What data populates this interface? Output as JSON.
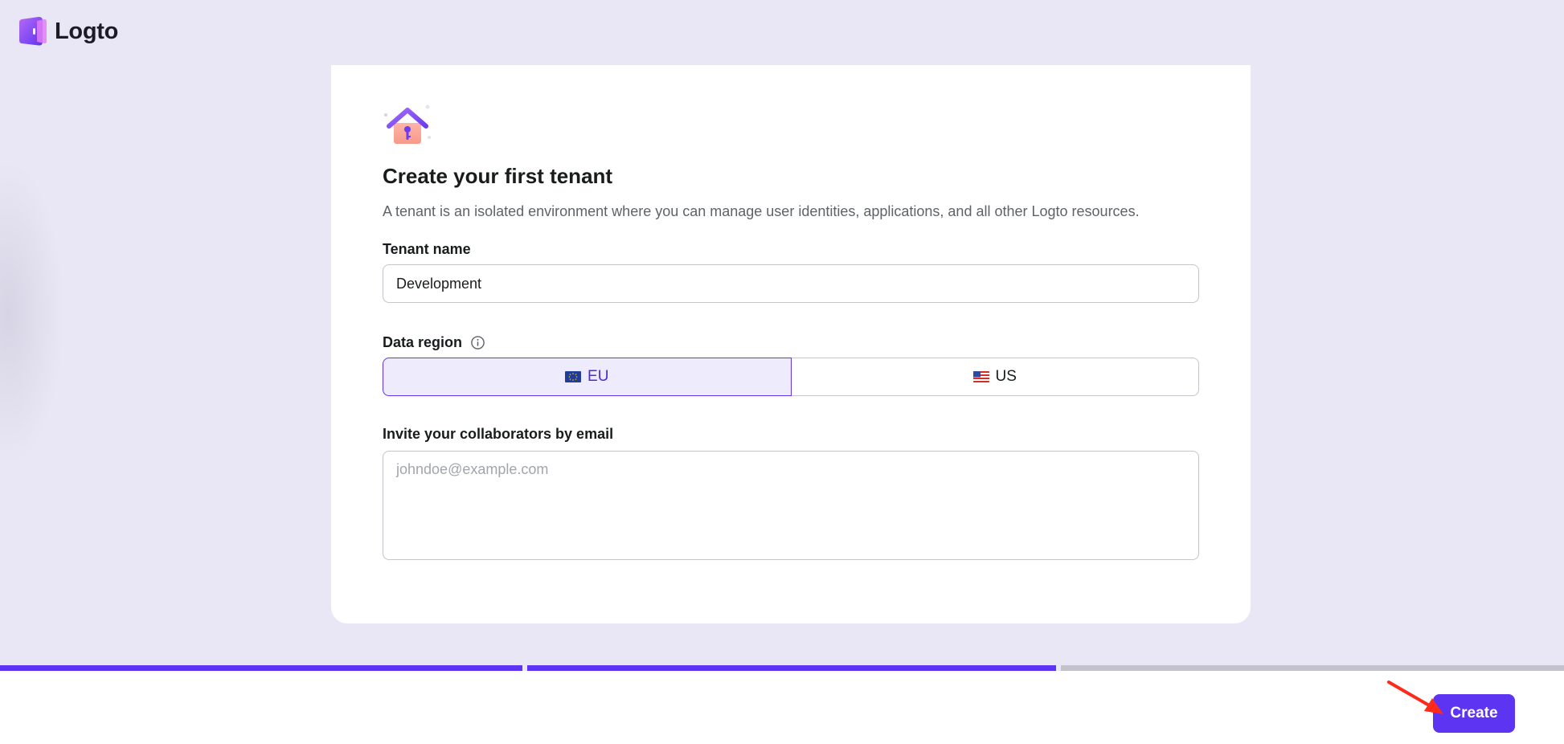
{
  "app": {
    "name": "Logto"
  },
  "card": {
    "title": "Create your first tenant",
    "description": "A tenant is an isolated environment where you can manage user identities, applications, and all other Logto resources."
  },
  "tenant_name": {
    "label": "Tenant name",
    "value": "Development"
  },
  "data_region": {
    "label": "Data region",
    "options": [
      {
        "label": "EU",
        "selected": true
      },
      {
        "label": "US",
        "selected": false
      }
    ]
  },
  "invite": {
    "label": "Invite your collaborators by email",
    "placeholder": "johndoe@example.com"
  },
  "progress": {
    "steps_total": 3,
    "steps_completed": 2
  },
  "footer": {
    "create_label": "Create"
  },
  "colors": {
    "primary": "#5d34f2",
    "background": "#e9e7f5",
    "card": "#ffffff",
    "annotation_arrow": "#ff2a1a"
  }
}
